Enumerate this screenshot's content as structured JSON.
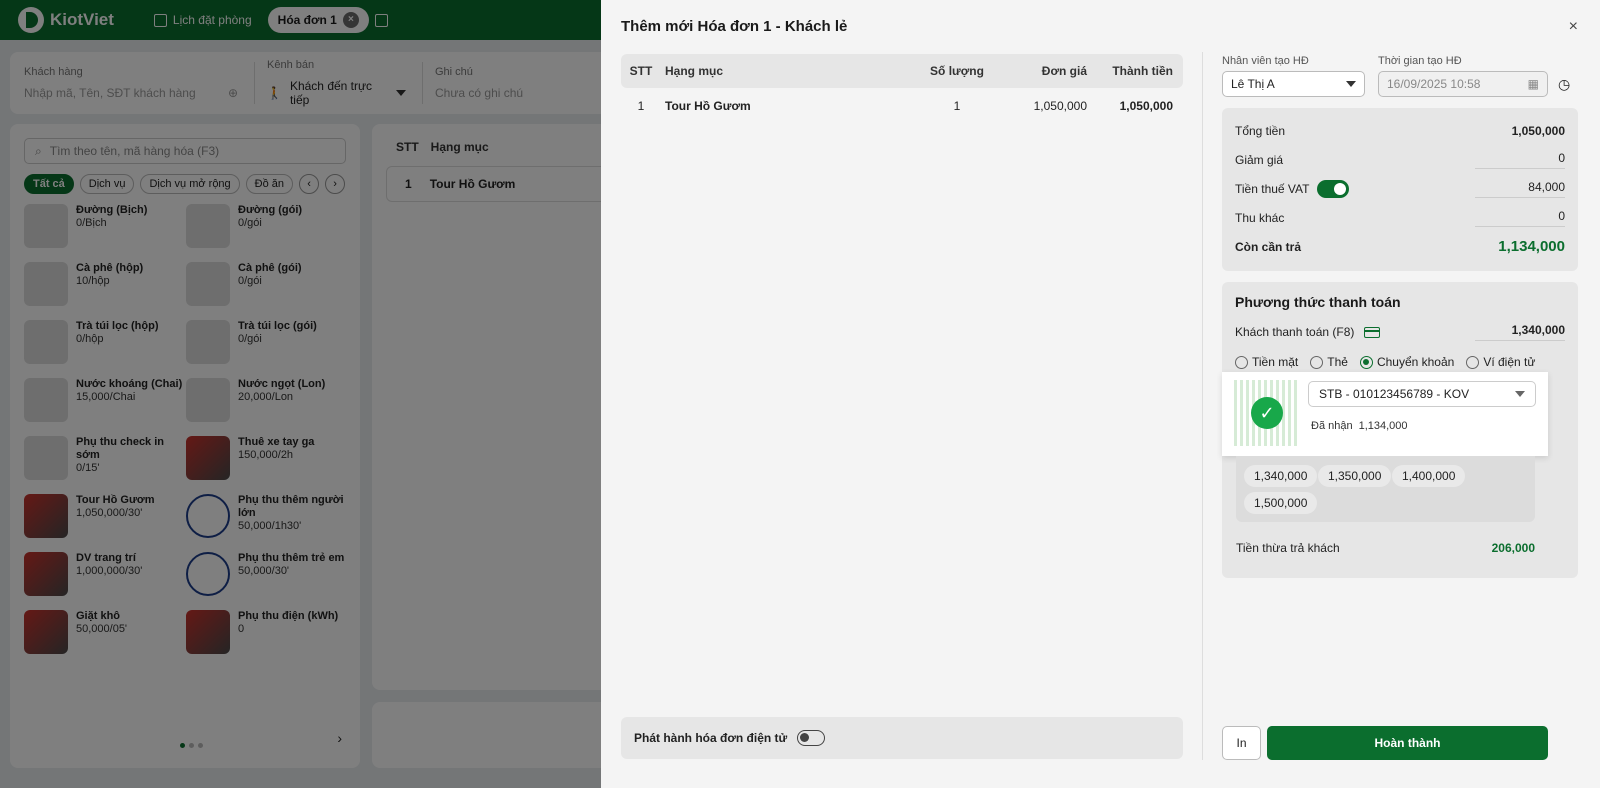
{
  "app": {
    "logo": "KiotViet",
    "tabs": [
      {
        "label": "Lịch đặt phòng"
      },
      {
        "label": "Hóa đơn 1"
      }
    ],
    "tab_close": "×"
  },
  "customer_bar": {
    "customer_label": "Khách hàng",
    "customer_placeholder": "Nhập mã, Tên, SĐT khách hàng",
    "channel_label": "Kênh bán",
    "channel_value": "Khách đến trực tiếp",
    "note_label": "Ghi chú",
    "note_placeholder": "Chưa có ghi chú"
  },
  "products": {
    "search_placeholder": "Tìm theo tên, mã hàng hóa (F3)",
    "categories": [
      "Tất cả",
      "Dịch vụ",
      "Dịch vụ mở rộng",
      "Đồ ăn"
    ],
    "prev": "‹",
    "next": "›",
    "pager_next": "›",
    "items": [
      {
        "name": "Đường (Bịch)",
        "price": "0/Bịch"
      },
      {
        "name": "Đường (gói)",
        "price": "0/gói"
      },
      {
        "name": "Cà phê (hộp)",
        "price": "10/hộp"
      },
      {
        "name": "Cà phê (gói)",
        "price": "0/gói"
      },
      {
        "name": "Trà túi lọc (hộp)",
        "price": "0/hộp"
      },
      {
        "name": "Trà túi lọc (gói)",
        "price": "0/gói"
      },
      {
        "name": "Nước khoáng (Chai)",
        "price": "15,000/Chai"
      },
      {
        "name": "Nước ngọt (Lon)",
        "price": "20,000/Lon"
      },
      {
        "name": "Phụ thu check in sớm",
        "price": "0/15'"
      },
      {
        "name": "Thuê xe tay ga",
        "price": "150,000/2h"
      },
      {
        "name": "Tour Hồ Gươm",
        "price": "1,050,000/30'"
      },
      {
        "name": "Phụ thu thêm người lớn",
        "price": "50,000/1h30'"
      },
      {
        "name": "DV trang trí",
        "price": "1,000,000/30'"
      },
      {
        "name": "Phụ thu thêm trẻ em",
        "price": "50,000/30'"
      },
      {
        "name": "Giặt khô",
        "price": "50,000/05'"
      },
      {
        "name": "Phụ thu điện (kWh)",
        "price": "0"
      }
    ]
  },
  "order_panel": {
    "col_stt": "STT",
    "col_item": "Hạng mục",
    "row_stt": "1",
    "row_item": "Tour Hồ Gươm"
  },
  "modal": {
    "title": "Thêm mới Hóa đơn 1 - Khách lẻ",
    "close": "×",
    "table": {
      "headers": {
        "stt": "STT",
        "item": "Hạng mục",
        "qty": "Số lượng",
        "price": "Đơn giá",
        "total": "Thành tiền"
      },
      "rows": [
        {
          "stt": "1",
          "item": "Tour Hồ Gươm",
          "qty": "1",
          "price": "1,050,000",
          "total": "1,050,000"
        }
      ]
    },
    "einvoice_label": "Phát hành hóa đơn điện tử",
    "staff_label": "Nhân viên tạo HĐ",
    "staff_value": "Lê Thị A",
    "time_label": "Thời gian tạo HĐ",
    "time_value": "16/09/2025 10:58",
    "summary": {
      "total_label": "Tổng tiền",
      "total_value": "1,050,000",
      "discount_label": "Giảm giá",
      "discount_value": "0",
      "vat_label": "Tiền thuế VAT",
      "vat_value": "84,000",
      "other_label": "Thu khác",
      "other_value": "0",
      "due_label": "Còn cần trả",
      "due_value": "1,134,000"
    },
    "payment": {
      "title": "Phương thức thanh toán",
      "customer_pay_label": "Khách thanh toán (F8)",
      "customer_pay_value": "1,340,000",
      "methods": [
        "Tiền mặt",
        "Thẻ",
        "Chuyển khoản",
        "Ví điện tử"
      ],
      "bank_account": "STB - 010123456789 - KOV",
      "received_label": "Đã nhận",
      "received_value": "1,134,000",
      "quick_amounts": [
        "1,340,000",
        "1,350,000",
        "1,400,000",
        "1,500,000"
      ],
      "change_label": "Tiền thừa trả khách",
      "change_value": "206,000"
    },
    "print_label": "In",
    "done_label": "Hoàn thành"
  },
  "colors": {
    "brand": "#0b6e2e",
    "success": "#18a84a"
  }
}
